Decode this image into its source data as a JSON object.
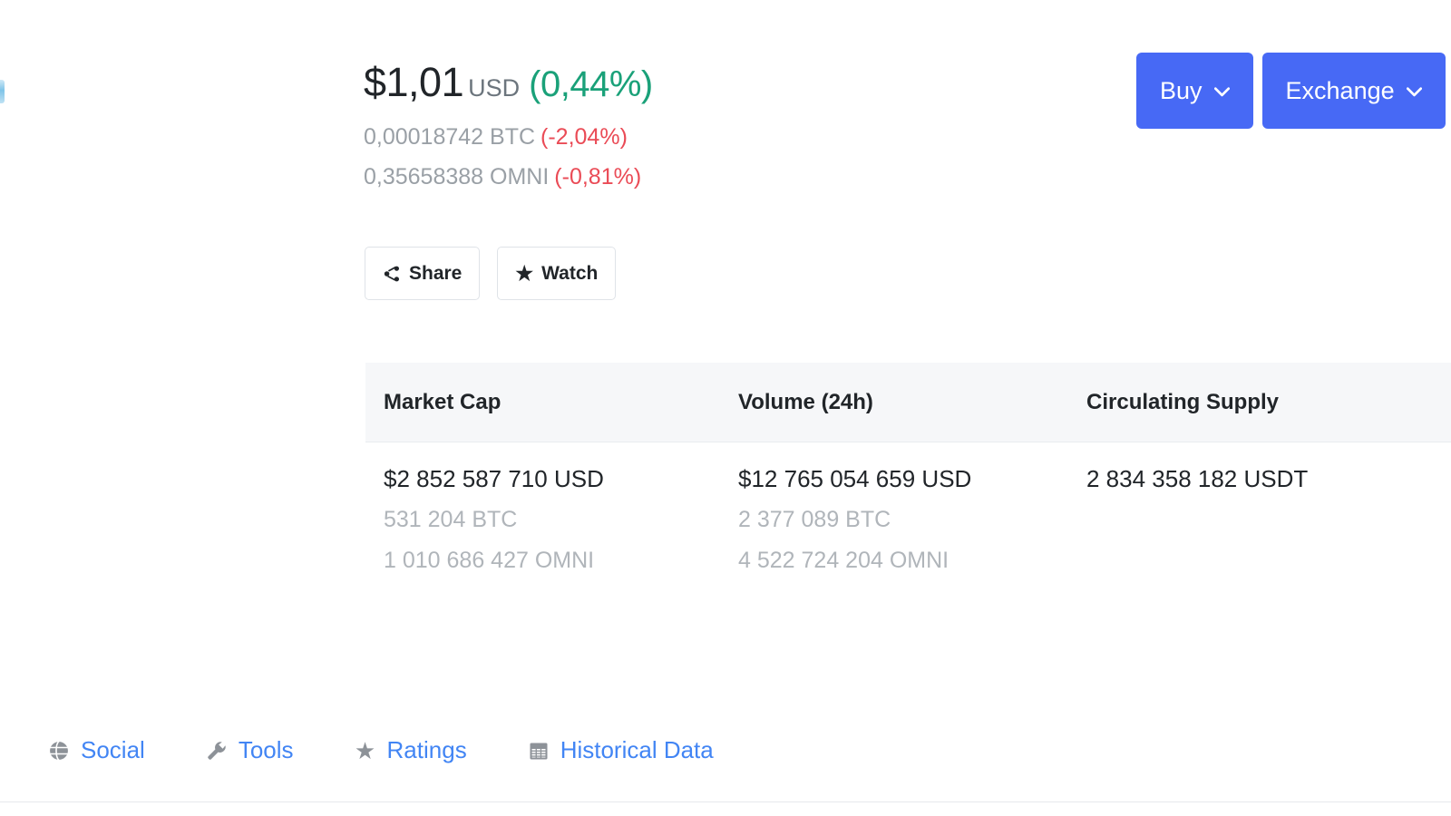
{
  "price": {
    "value": "$1,01",
    "unit": "USD",
    "change": "(0,44%)",
    "change_direction": "up",
    "btc_amount": "0,00018742 BTC",
    "btc_change": "(-2,04%)",
    "btc_change_direction": "down",
    "omni_amount": "0,35658388 OMNI",
    "omni_change": "(-0,81%)",
    "omni_change_direction": "down"
  },
  "actions": {
    "share_label": "Share",
    "watch_label": "Watch",
    "watch_glyph": "★"
  },
  "topright": {
    "buy_label": "Buy",
    "exchange_label": "Exchange",
    "caret_glyph": "❯"
  },
  "stats": {
    "columns": [
      {
        "header": "Market Cap",
        "primary": "$2 852 587 710 USD",
        "sub1": "531 204 BTC",
        "sub2": "1 010 686 427 OMNI"
      },
      {
        "header": "Volume (24h)",
        "primary": "$12 765 054 659 USD",
        "sub1": "2 377 089 BTC",
        "sub2": "4 522 724 204 OMNI"
      },
      {
        "header": "Circulating Supply",
        "primary": "2 834 358 182 USDT",
        "sub1": "",
        "sub2": ""
      }
    ]
  },
  "footer_nav": {
    "items": [
      {
        "label": "Social",
        "icon": "globe-icon"
      },
      {
        "label": "Tools",
        "icon": "wrench-icon"
      },
      {
        "label": "Ratings",
        "icon": "star-icon"
      },
      {
        "label": "Historical Data",
        "icon": "calendar-icon"
      }
    ]
  },
  "colors": {
    "up": "#1aa179",
    "down": "#ea4b56",
    "primary_button": "#4769f5",
    "link": "#4285f4",
    "header_band": "#f6f7f9",
    "muted_text": "#9aa0a6"
  }
}
